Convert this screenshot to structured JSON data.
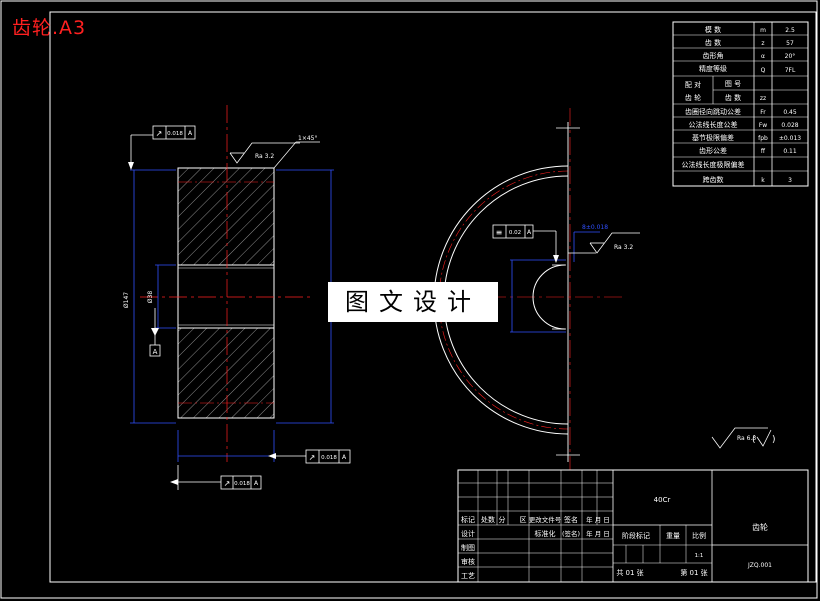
{
  "file_title": "齿轮.A3",
  "watermark": "图文设计",
  "params": {
    "rows": [
      {
        "name": "模 数",
        "sym": "m",
        "val": "2.5"
      },
      {
        "name": "齿 数",
        "sym": "z",
        "val": "57"
      },
      {
        "name": "齿形角",
        "sym": "α",
        "val": "20°"
      },
      {
        "name": "精度等级",
        "sym": "Q",
        "val": "7FL"
      },
      {
        "name": "配 对",
        "sym": "",
        "val": ""
      },
      {
        "name": "齿 轮",
        "sym": "",
        "val": ""
      },
      {
        "name": "齿圈径向跳动公差",
        "sym": "Fr",
        "val": "0.45"
      },
      {
        "name": "公法线长度公差",
        "sym": "Fw",
        "val": "0.028"
      },
      {
        "name": "基节极限偏差",
        "sym": "fpb",
        "val": "±0.013"
      },
      {
        "name": "齿形公差",
        "sym": "ff",
        "val": "0.11"
      },
      {
        "name": "公法线长度极限偏差",
        "sym": "",
        "val": ""
      },
      {
        "name": "跨齿数",
        "sym": "k",
        "val": "3"
      }
    ],
    "pair_sub": {
      "tuhao": "图 号",
      "chishu": "齿 数",
      "z": "zz"
    }
  },
  "annotations": {
    "chamfer": "1×45°",
    "ra_left": "Ra 3.2",
    "ra_right": "Ra 3.2",
    "ra_general": "Ra 6.3",
    "tol_runout_top": "0.018",
    "tol_runout_bottom1": "0.018",
    "tol_runout_bottom2": "0.018",
    "tol_sym": "0.02",
    "datum_a": "A",
    "keyway_dim": "8±0.018",
    "dim_od": "Ø147",
    "dim_bore": "Ø38"
  },
  "title_block": {
    "material": "40Cr",
    "part_name": "齿轮",
    "drawing_no": "JZQ.001",
    "scale": "1:1",
    "sheets": "共 01 张",
    "sheet_no": "第 01 张",
    "labels": {
      "biaoji": "标记",
      "chushu": "处数",
      "fenqu": "分",
      "qu": "区",
      "gengai": "更改文件号",
      "qianming": "签名",
      "nianyueri": "年 月 日",
      "sheji": "设计",
      "biaozhunhua": "标准化",
      "qianming2": "(签名)",
      "nianyueri2": "年 月 日",
      "zhitu": "制图",
      "shenhe": "审核",
      "gongyi": "工艺",
      "jieduan": "阶段标记",
      "zhongliang": "重量",
      "bili": "比例"
    }
  }
}
